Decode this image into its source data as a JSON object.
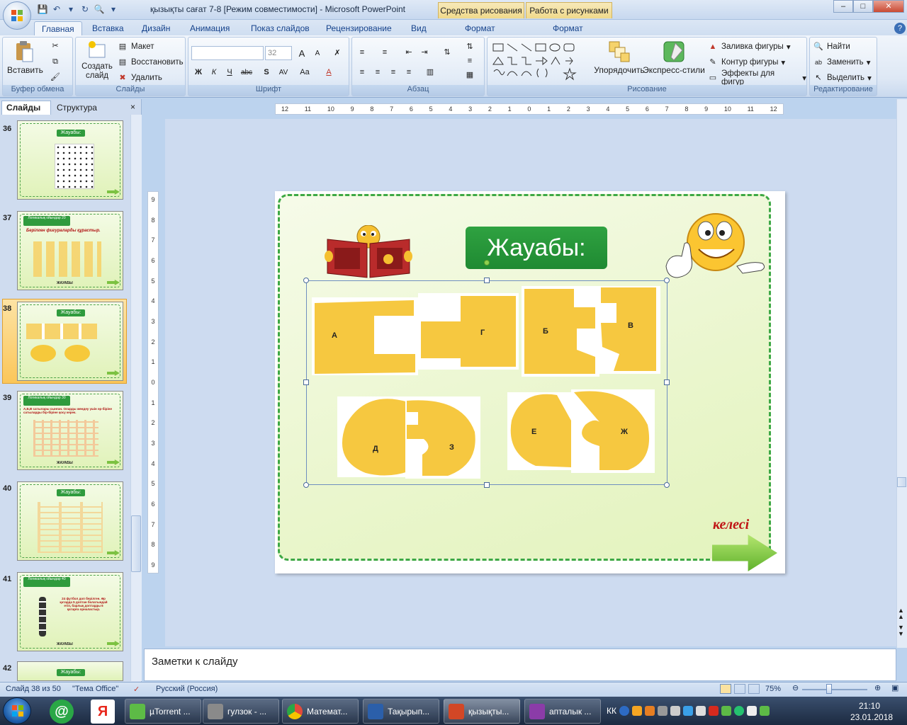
{
  "window": {
    "title": "қызықты сағат 7-8 [Режим совместимости] - Microsoft PowerPoint",
    "context_tabs": [
      "Средства рисования",
      "Работа с рисунками"
    ],
    "controls": [
      "–",
      "□",
      "✕"
    ]
  },
  "tabs": [
    {
      "label": "Главная",
      "active": true
    },
    {
      "label": "Вставка"
    },
    {
      "label": "Дизайн"
    },
    {
      "label": "Анимация"
    },
    {
      "label": "Показ слайдов"
    },
    {
      "label": "Рецензирование"
    },
    {
      "label": "Вид"
    },
    {
      "label": "Формат"
    },
    {
      "label": "Формат"
    }
  ],
  "ribbon": {
    "clipboard": {
      "label": "Буфер обмена",
      "paste": "Вставить"
    },
    "slides": {
      "label": "Слайды",
      "new_slide": "Создать слайд",
      "layout": "Макет",
      "reset": "Восстановить",
      "delete": "Удалить"
    },
    "font": {
      "label": "Шрифт",
      "font_name": "",
      "font_size": "32",
      "bold": "Ж",
      "italic": "К",
      "underline": "Ч",
      "strike": "abc",
      "shadow": "S",
      "spacing": "AV",
      "case": "Aa",
      "color": "A",
      "grow": "A",
      "shrink": "A"
    },
    "paragraph": {
      "label": "Абзац"
    },
    "drawing": {
      "label": "Рисование",
      "arrange": "Упорядочить",
      "quick_styles": "Экспресс-стили",
      "fill": "Заливка фигуры",
      "outline": "Контур фигуры",
      "effects": "Эффекты для фигур"
    },
    "editing": {
      "label": "Редактирование",
      "find": "Найти",
      "replace": "Заменить",
      "select": "Выделить"
    }
  },
  "left_pane": {
    "tab_slides": "Слайды",
    "tab_outline": "Структура",
    "close": "×",
    "thumbnails": [
      {
        "num": "36",
        "title": "Жауабы:"
      },
      {
        "num": "37",
        "title": "Логикалық ойындар 20",
        "subtitle": "Берілген фигураларды құрастыр.",
        "footer": "ЖАУАБЫ"
      },
      {
        "num": "38",
        "title": "Жауабы:",
        "selected": true
      },
      {
        "num": "39",
        "title": "Логикалық ойындар 30",
        "subtitle": "А,Б,В сатылары сынған. Оларды жөндеу үшін әр-бiрiне сатыларды бір-біріне қосу керек.",
        "footer": "ЖАУАБЫ"
      },
      {
        "num": "40",
        "title": "Жауабы:"
      },
      {
        "num": "41",
        "title": "Логикалық ойындар 40",
        "subtitle": "24 футбол доп берілген. Әр қатарда 5 доптан болатындай етіп, барлық доптарды 6 қатарға орналастыр.",
        "footer": "ЖАУАБЫ"
      },
      {
        "num": "42",
        "title": "Жауабы:"
      }
    ]
  },
  "ruler": {
    "h_ticks": [
      "12",
      "11",
      "10",
      "9",
      "8",
      "7",
      "6",
      "5",
      "4",
      "3",
      "2",
      "1",
      "0",
      "1",
      "2",
      "3",
      "4",
      "5",
      "6",
      "7",
      "8",
      "9",
      "10",
      "11",
      "12"
    ],
    "v_ticks": [
      "9",
      "8",
      "7",
      "6",
      "5",
      "4",
      "3",
      "2",
      "1",
      "0",
      "1",
      "2",
      "3",
      "4",
      "5",
      "6",
      "7",
      "8",
      "9"
    ]
  },
  "slide": {
    "title": "Жауабы:",
    "pieces": [
      "А",
      "Г",
      "Б",
      "В",
      "Д",
      "З",
      "Е",
      "Ж"
    ],
    "next_label": "келесі"
  },
  "notes": {
    "placeholder": "Заметки к слайду"
  },
  "status": {
    "slide": "Слайд 38 из 50",
    "theme": "\"Тема Office\"",
    "language": "Русский (Россия)",
    "zoom": "75%"
  },
  "taskbar": {
    "apps": [
      {
        "label": "µTorrent ...",
        "color": "#5dbb46"
      },
      {
        "label": "гулзок - ...",
        "color": "#8a8a8a"
      },
      {
        "label": "Математ...",
        "color": "#e24a3b"
      },
      {
        "label": "Тақырып...",
        "color": "#2b5faa"
      },
      {
        "label": "қызықты...",
        "color": "#d24726",
        "active": true
      },
      {
        "label": "апталык ...",
        "color": "#8b3ca8"
      }
    ],
    "lang": "КК",
    "time": "21:10",
    "date": "23.01.2018"
  }
}
